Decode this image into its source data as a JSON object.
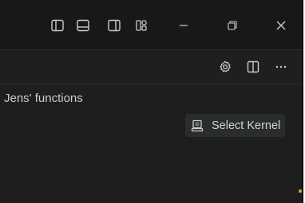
{
  "titlebar": {
    "icons": [
      {
        "name": "toggle-primary-sidebar-icon"
      },
      {
        "name": "toggle-panel-icon"
      },
      {
        "name": "toggle-secondary-sidebar-icon"
      },
      {
        "name": "customize-layout-icon"
      },
      {
        "name": "minimize-icon"
      },
      {
        "name": "restore-icon"
      },
      {
        "name": "close-icon"
      }
    ]
  },
  "editor_toolbar": {
    "icons": [
      {
        "name": "gear-icon"
      },
      {
        "name": "split-editor-icon"
      },
      {
        "name": "more-actions-icon"
      }
    ]
  },
  "notebook": {
    "text": "Jens' functions"
  },
  "kernel": {
    "label": "Select Kernel",
    "icon": "kernel-icon"
  },
  "colors": {
    "titlebar_bg": "#181818",
    "editor_bg": "#1e1e1e",
    "icon_fg": "#cccccc",
    "accent_dot": "#c9a227"
  }
}
